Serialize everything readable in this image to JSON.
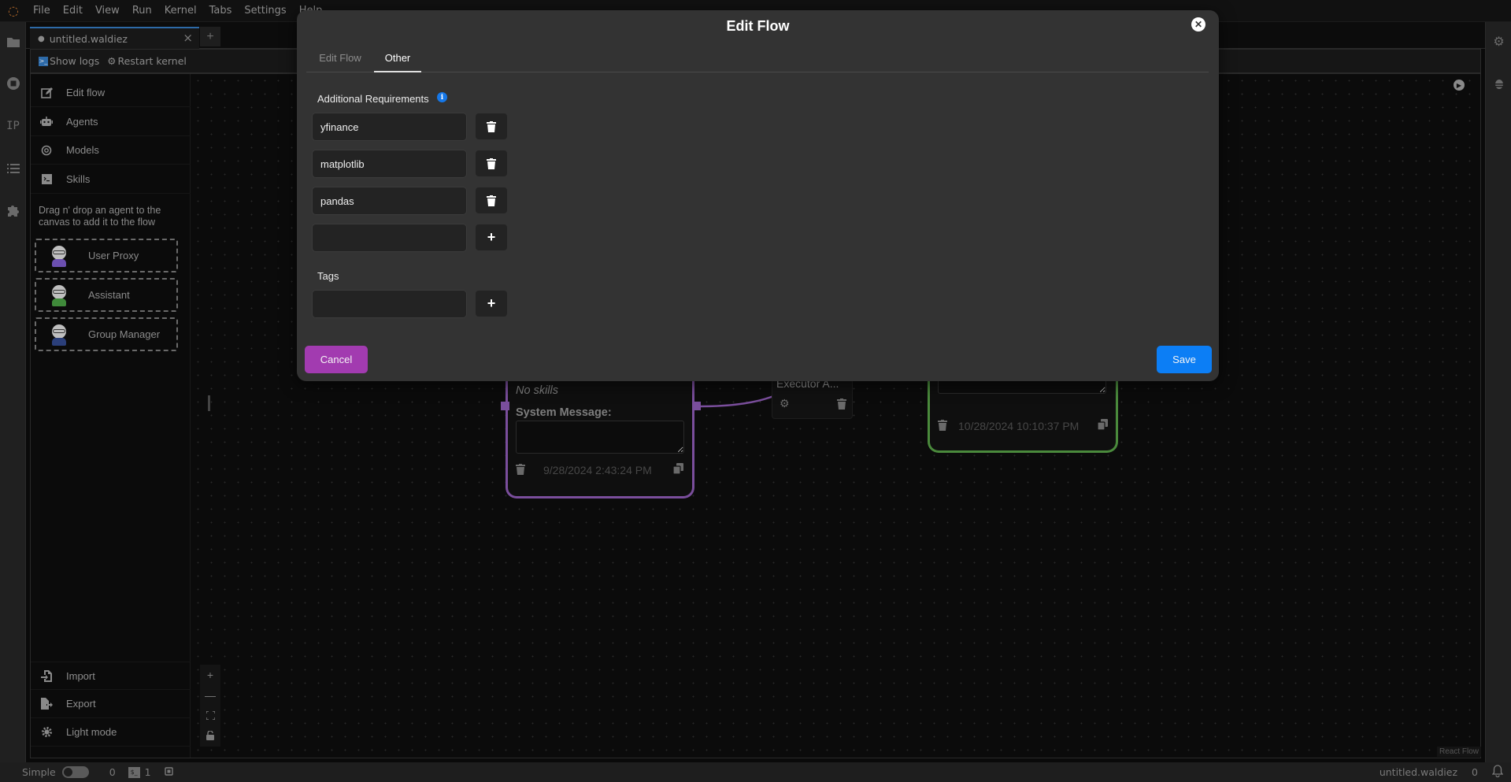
{
  "menubar": {
    "items": [
      "File",
      "Edit",
      "View",
      "Run",
      "Kernel",
      "Tabs",
      "Settings",
      "Help"
    ]
  },
  "left_rail": {
    "icons": [
      "folder-icon",
      "stop-circle-icon",
      "ip-icon",
      "list-icon",
      "puzzle-icon"
    ],
    "ip_label": "IP"
  },
  "right_rail": {
    "icons": [
      "gears-icon",
      "bug-icon"
    ]
  },
  "document_tab": {
    "title": "untitled.waldiez",
    "close": "×",
    "new_tab": "+"
  },
  "toolbar": {
    "show_logs": "Show logs",
    "restart_kernel": "Restart kernel"
  },
  "flow_sidebar": {
    "items": [
      {
        "label": "Edit flow",
        "icon": "edit-icon"
      },
      {
        "label": "Agents",
        "icon": "robot-icon"
      },
      {
        "label": "Models",
        "icon": "openai-icon"
      },
      {
        "label": "Skills",
        "icon": "terminal-icon"
      }
    ],
    "hint": "Drag n' drop an agent to the canvas to add it to the flow",
    "agents": [
      {
        "label": "User Proxy",
        "color": "#6b4fb0"
      },
      {
        "label": "Assistant",
        "color": "#3f8a3a"
      },
      {
        "label": "Group Manager",
        "color": "#2b3f7a"
      }
    ],
    "bottom_items": [
      {
        "label": "Import",
        "icon": "import-icon"
      },
      {
        "label": "Export",
        "icon": "export-icon"
      },
      {
        "label": "Light mode",
        "icon": "sun-icon"
      }
    ]
  },
  "canvas": {
    "controls": [
      "+",
      "—",
      "⛶",
      "🔓"
    ],
    "attribution": "React Flow",
    "nodes": {
      "purple": {
        "skills_text": "No skills",
        "system_message_label": "System Message:",
        "date": "9/28/2024 2:43:24 PM"
      },
      "executor": {
        "label": "Executor A..."
      },
      "green": {
        "date": "10/28/2024 10:10:37 PM"
      }
    }
  },
  "modal": {
    "title": "Edit Flow",
    "tabs": [
      {
        "label": "Edit Flow",
        "active": false
      },
      {
        "label": "Other",
        "active": true
      }
    ],
    "additional_requirements": {
      "label": "Additional Requirements",
      "items": [
        "yfinance",
        "matplotlib",
        "pandas"
      ],
      "new_value": "",
      "new_placeholder": ""
    },
    "tags": {
      "label": "Tags",
      "new_value": "",
      "new_placeholder": ""
    },
    "cancel_label": "Cancel",
    "save_label": "Save",
    "colors": {
      "cancel": "#a23bb0",
      "save": "#0c7ef5",
      "info": "#1577e8"
    }
  },
  "statusbar": {
    "mode_label": "Simple",
    "count_a": "0",
    "terminal_badge": "$_",
    "count_b": "1",
    "filename": "untitled.waldiez",
    "notifications": "0"
  }
}
